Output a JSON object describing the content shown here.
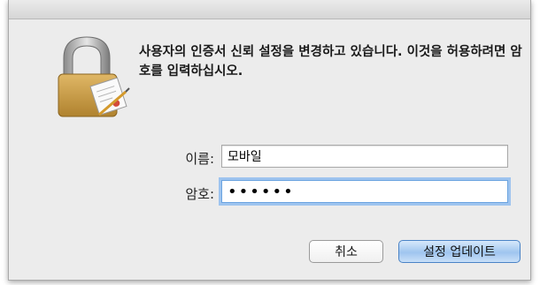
{
  "dialog": {
    "message": "사용자의 인증서 신뢰 설정을 변경하고 있습니다. 이것을 허용하려면 암호를 입력하십시오.",
    "icon": "lock-icon"
  },
  "form": {
    "name_label": "이름:",
    "name_value": "모바일",
    "password_label": "암호:",
    "password_value": "••••••"
  },
  "buttons": {
    "cancel_label": "취소",
    "update_label": "설정 업데이트"
  },
  "colors": {
    "window_bg": "#ececec",
    "focus_ring": "#9ec4ef",
    "default_button": "#9fc5ef"
  }
}
